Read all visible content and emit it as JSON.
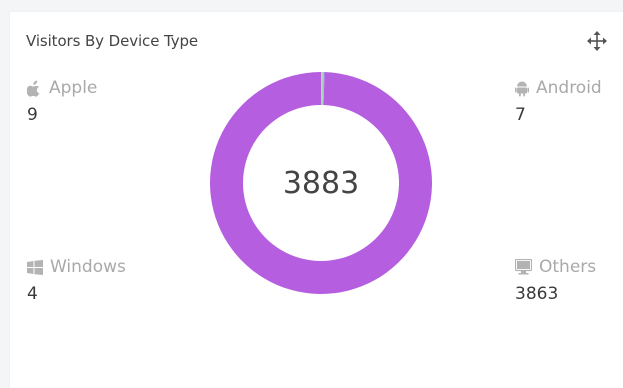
{
  "widget": {
    "title": "Visitors By Device Type",
    "move_icon": "move-arrows-icon"
  },
  "metrics": {
    "apple": {
      "label": "Apple",
      "value": "9",
      "icon": "apple-icon"
    },
    "android": {
      "label": "Android",
      "value": "7",
      "icon": "android-icon"
    },
    "windows": {
      "label": "Windows",
      "value": "4",
      "icon": "windows-icon"
    },
    "others": {
      "label": "Others",
      "value": "3863",
      "icon": "monitor-icon"
    }
  },
  "donut": {
    "total": "3883",
    "colors": {
      "apple": "#c9c9c9",
      "android": "#8fd3a9",
      "windows": "#7fb6e6",
      "others": "#b55fe0"
    }
  },
  "chart_data": {
    "type": "pie",
    "categories": [
      "Apple",
      "Android",
      "Windows",
      "Others"
    ],
    "values": [
      9,
      7,
      4,
      3863
    ],
    "title": "Visitors By Device Type"
  }
}
